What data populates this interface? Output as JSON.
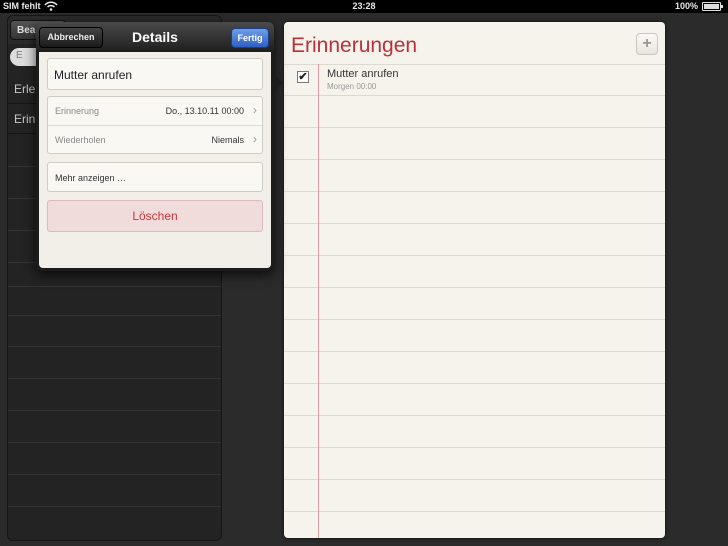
{
  "status_bar": {
    "carrier": "SIM fehlt",
    "time": "23:28",
    "battery": "100%"
  },
  "left_pane": {
    "edit_label": "Bear",
    "search_placeholder": "E",
    "items": [
      {
        "label": "Erle"
      },
      {
        "label": "Erin"
      }
    ]
  },
  "reminders": {
    "title": "Erinnerungen",
    "add_label": "+",
    "items": [
      {
        "title": "Mutter anrufen",
        "subtitle": "Morgen 00:00",
        "checked": true
      }
    ]
  },
  "details_popover": {
    "cancel_label": "Abbrechen",
    "title": "Details",
    "done_label": "Fertig",
    "task_title": "Mutter anrufen",
    "rows": [
      {
        "label": "Erinnerung",
        "value": "Do., 13.10.11 00:00"
      },
      {
        "label": "Wiederholen",
        "value": "Niemals"
      }
    ],
    "more_label": "Mehr anzeigen …",
    "delete_label": "Löschen"
  },
  "colors": {
    "title_red": "#b8323a",
    "done_blue": "#2f5fc7",
    "delete_red": "#c9343a"
  }
}
